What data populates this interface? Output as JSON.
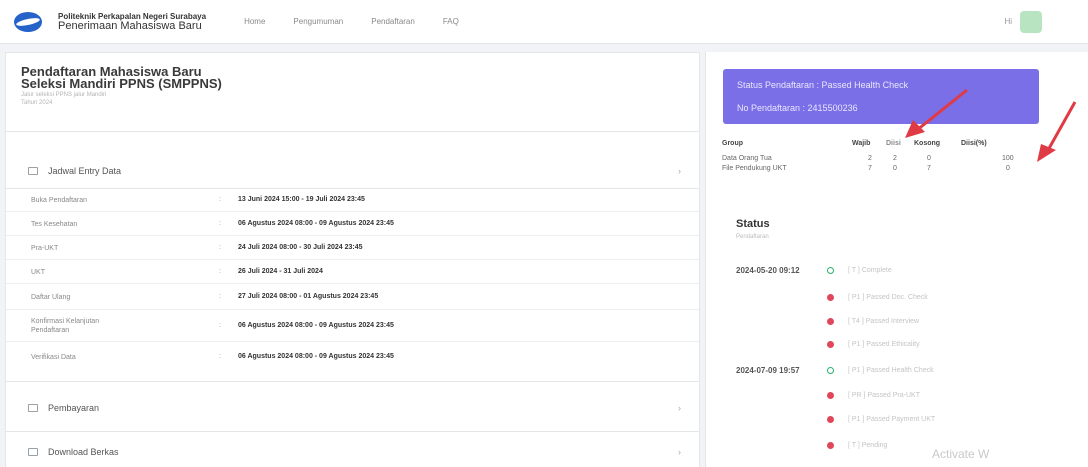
{
  "navbar": {
    "brand_top": "Politeknik Perkapalan Negeri Surabaya",
    "brand_sub": "Penerimaan Mahasiswa Baru",
    "links": [
      "Home",
      "Pengumuman",
      "Pendaftaran",
      "FAQ"
    ],
    "user": "Hi"
  },
  "page": {
    "title_line1": "Pendaftaran Mahasiswa Baru",
    "title_line2": "Seleksi Mandiri PPNS (SMPPNS)",
    "desc_line1": "Jalur seleksi PPNS jalur Mandiri",
    "desc_line2": "Tahun 2024"
  },
  "sections": {
    "jadwal": "Jadwal Entry Data",
    "pembayaran": "Pembayaran",
    "download": "Download Berkas"
  },
  "jadwal_rows": [
    {
      "key": "Buka Pendaftaran",
      "value": "13 Juni 2024 15:00 - 19 Juli 2024 23:45"
    },
    {
      "key": "Tes Kesehatan",
      "value": "06 Agustus 2024 08:00 - 09 Agustus 2024 23:45"
    },
    {
      "key": "Pra-UKT",
      "value": "24 Juli 2024 08:00 - 30 Juli 2024 23:45"
    },
    {
      "key": "UKT",
      "value": "26 Juli 2024 - 31 Juli 2024"
    },
    {
      "key": "Daftar Ulang",
      "value": "27 Juli 2024 08:00 - 01 Agustus 2024 23:45"
    },
    {
      "key": "Konfirmasi Kelanjutan Pendaftaran",
      "value": "06 Agustus 2024 08:00 - 09 Agustus 2024 23:45"
    },
    {
      "key": "Verifikasi Data",
      "value": "06 Agustus 2024 08:00 - 09 Agustus 2024 23:45"
    }
  ],
  "status_card": {
    "line1": "Status Pendaftaran : Passed Health Check",
    "line2": "No Pendaftaran : 2415500236"
  },
  "group_table": {
    "headers": [
      "Group",
      "Wajib",
      "Diisi",
      "Kosong",
      "Diisi(%)"
    ],
    "rows": [
      [
        "Data Orang Tua",
        "2",
        "2",
        "0",
        "100"
      ],
      [
        "File Pendukung UKT",
        "7",
        "0",
        "7",
        "0"
      ]
    ]
  },
  "status": {
    "title": "Status",
    "subtitle": "Pendaftaran",
    "timeline": [
      {
        "date": "2024-05-20 09:12",
        "entries": [
          "[ T ] Complete",
          "[ P1 ] Passed Doc. Check",
          "[ T4 ] Passed Interview",
          "[ P1 ] Passed Ethicality"
        ]
      },
      {
        "date": "2024-07-09 19:57",
        "entries": [
          "[ P1 ] Passed Health Check",
          "[ PR ] Passed Pra-UKT",
          "[ P1 ] Passed Payment UKT",
          "[ T ] Pending"
        ]
      }
    ]
  },
  "watermark": "Activate W",
  "colors": {
    "status_card": "#7a6fe6",
    "arrow": "#e03a45",
    "dot_green": "#27b36b",
    "dot_red": "#e0475b"
  }
}
